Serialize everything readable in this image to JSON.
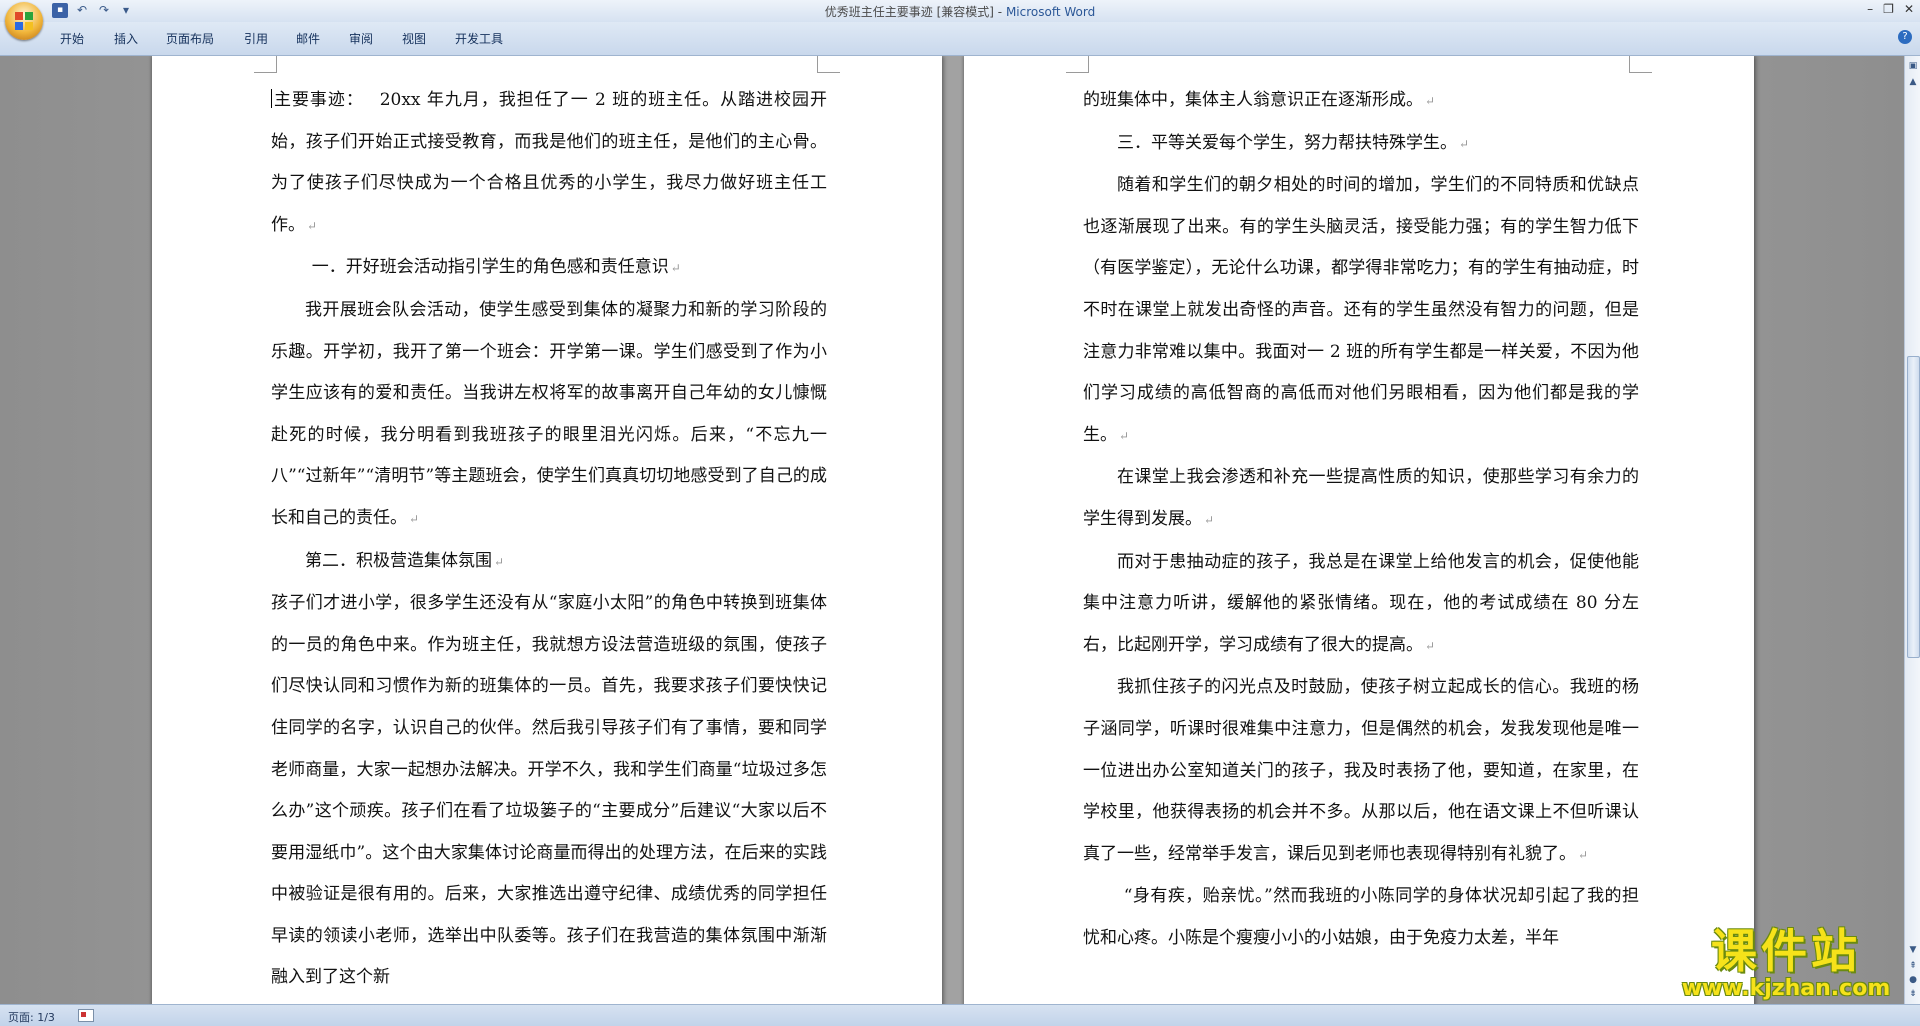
{
  "window": {
    "title_doc": "优秀班主任主要事迹 [兼容模式]",
    "title_sep": " - ",
    "title_app": "Microsoft Word"
  },
  "quick_access": {
    "save_icon": "save-icon",
    "undo_icon": "undo-icon",
    "redo_icon": "redo-icon"
  },
  "ribbon": {
    "tabs": [
      "开始",
      "插入",
      "页面布局",
      "引用",
      "邮件",
      "审阅",
      "视图",
      "开发工具"
    ]
  },
  "document": {
    "left_page": [
      {
        "style": "first",
        "text": "主要事迹：　 20xx 年九月，我担任了一 2 班的班主任。从踏进校园开始，孩子们开始正式接受教育，而我是他们的班主任，是他们的主心骨。为了使孩子们尽快成为一个合格且优秀的小学生，我尽力做好班主任工作。"
      },
      {
        "style": "head",
        "text": "一．开好班会活动指引学生的角色感和责任意识"
      },
      {
        "style": "ind",
        "text": "我开展班会队会活动，使学生感受到集体的凝聚力和新的学习阶段的乐趣。开学初，我开了第一个班会：开学第一课。学生们感受到了作为小学生应该有的爱和责任。当我讲左权将军的故事离开自己年幼的女儿慷慨赴死的时候，我分明看到我班孩子的眼里泪光闪烁。后来，“不忘九一八”“过新年”“清明节”等主题班会，使学生们真真切切地感受到了自己的成长和自己的责任。"
      },
      {
        "style": "head2",
        "text": "第二．积极营造集体氛围"
      },
      {
        "style": "plain",
        "text": "孩子们才进小学，很多学生还没有从“家庭小太阳”的角色中转换到班集体的一员的角色中来。作为班主任，我就想方设法营造班级的氛围，使孩子们尽快认同和习惯作为新的班集体的一员。首先，我要求孩子们要快快记住同学的名字，认识自己的伙伴。然后我引导孩子们有了事情，要和同学老师商量，大家一起想办法解决。开学不久，我和学生们商量“垃圾过多怎么办”这个顽疾。孩子们在看了垃圾篓子的“主要成分”后建议“大家以后不要用湿纸巾”。这个由大家集体讨论商量而得出的处理方法，在后来的实践中被验证是很有用的。后来，大家推选出遵守纪律、成绩优秀的同学担任早读的领读小老师，选举出中队委等。孩子们在我营造的集体氛围中渐渐融入到了这个新"
      }
    ],
    "right_page": [
      {
        "style": "plain",
        "text": "的班集体中，集体主人翁意识正在逐渐形成。"
      },
      {
        "style": "ind",
        "text": "三．平等关爱每个学生，努力帮扶特殊学生。"
      },
      {
        "style": "ind",
        "text": "随着和学生们的朝夕相处的时间的增加，学生们的不同特质和优缺点也逐渐展现了出来。有的学生头脑灵活，接受能力强；有的学生智力低下（有医学鉴定），无论什么功课，都学得非常吃力；有的学生有抽动症，时不时在课堂上就发出奇怪的声音。还有的学生虽然没有智力的问题，但是注意力非常难以集中。我面对一 2 班的所有学生都是一样关爱，不因为他们学习成绩的高低智商的高低而对他们另眼相看，因为他们都是我的学生。"
      },
      {
        "style": "ind",
        "text": "在课堂上我会渗透和补充一些提高性质的知识，使那些学习有余力的学生得到发展。"
      },
      {
        "style": "ind",
        "text": "而对于患抽动症的孩子，我总是在课堂上给他发言的机会，促使他能集中注意力听讲，缓解他的紧张情绪。现在，他的考试成绩在 80 分左右，比起刚开学，学习成绩有了很大的提高。"
      },
      {
        "style": "ind",
        "text": "我抓住孩子的闪光点及时鼓励，使孩子树立起成长的信心。我班的杨子涵同学，听课时很难集中注意力，但是偶然的机会，发我发现他是唯一一位进出办公室知道关门的孩子，我及时表扬了他，要知道，在家里，在学校里，他获得表扬的机会并不多。从那以后，他在语文课上不但听课认真了一些，经常举手发言，课后见到老师也表现得特别有礼貌了。"
      },
      {
        "style": "quote",
        "text": "“身有疾，贻亲忧。”然而我班的小陈同学的身体状况却引起了我的担忧和心疼。小陈是个瘦瘦小小的小姑娘，由于免疫力太差，半年"
      }
    ]
  },
  "statusbar": {
    "page_info": "页面: 1/3"
  },
  "watermark": {
    "main": "课件站",
    "sub": "www.kjzhan.com"
  }
}
